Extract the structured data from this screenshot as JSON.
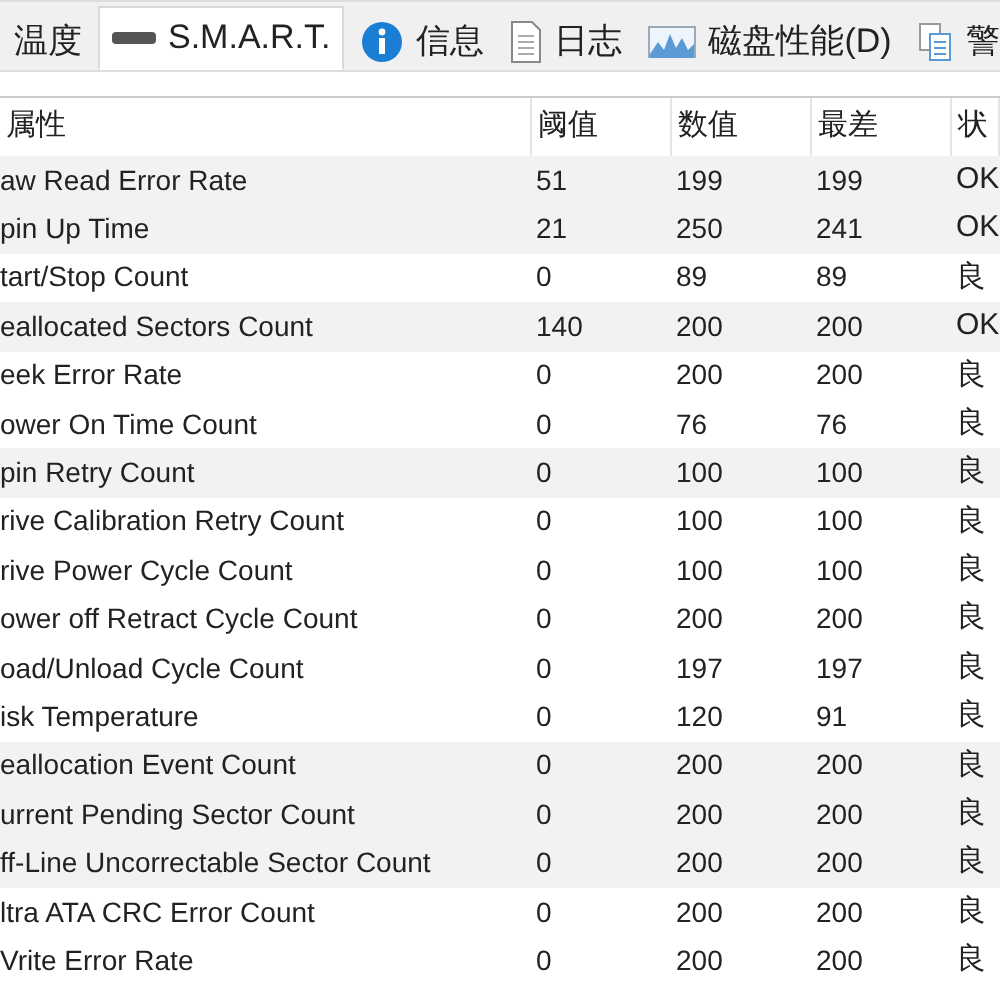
{
  "tabs": [
    {
      "label": "温度",
      "selected": false
    },
    {
      "label": "S.M.A.R.T.",
      "selected": true
    },
    {
      "label": "信息",
      "selected": false
    },
    {
      "label": "日志",
      "selected": false
    },
    {
      "label": "磁盘性能(D)",
      "selected": false
    },
    {
      "label": "警",
      "selected": false
    }
  ],
  "table": {
    "columns": [
      "属性",
      "阈值",
      "数值",
      "最差",
      "状"
    ],
    "rows": [
      {
        "attribute": "aw Read Error Rate",
        "threshold": "51",
        "value": "199",
        "worst": "199",
        "status": "OK",
        "highlighted": true
      },
      {
        "attribute": "pin Up Time",
        "threshold": "21",
        "value": "250",
        "worst": "241",
        "status": "OK",
        "highlighted": true
      },
      {
        "attribute": "tart/Stop Count",
        "threshold": "0",
        "value": "89",
        "worst": "89",
        "status": "良",
        "highlighted": false
      },
      {
        "attribute": "eallocated Sectors Count",
        "threshold": "140",
        "value": "200",
        "worst": "200",
        "status": "OK",
        "highlighted": true
      },
      {
        "attribute": "eek Error Rate",
        "threshold": "0",
        "value": "200",
        "worst": "200",
        "status": "良",
        "highlighted": false
      },
      {
        "attribute": "ower On Time Count",
        "threshold": "0",
        "value": "76",
        "worst": "76",
        "status": "良",
        "highlighted": false
      },
      {
        "attribute": "pin Retry Count",
        "threshold": "0",
        "value": "100",
        "worst": "100",
        "status": "良",
        "highlighted": true
      },
      {
        "attribute": "rive Calibration Retry Count",
        "threshold": "0",
        "value": "100",
        "worst": "100",
        "status": "良",
        "highlighted": false
      },
      {
        "attribute": "rive Power Cycle Count",
        "threshold": "0",
        "value": "100",
        "worst": "100",
        "status": "良",
        "highlighted": false
      },
      {
        "attribute": "ower off Retract Cycle Count",
        "threshold": "0",
        "value": "200",
        "worst": "200",
        "status": "良",
        "highlighted": false
      },
      {
        "attribute": "oad/Unload Cycle Count",
        "threshold": "0",
        "value": "197",
        "worst": "197",
        "status": "良",
        "highlighted": false
      },
      {
        "attribute": "isk Temperature",
        "threshold": "0",
        "value": "120",
        "worst": "91",
        "status": "良",
        "highlighted": false
      },
      {
        "attribute": "eallocation Event Count",
        "threshold": "0",
        "value": "200",
        "worst": "200",
        "status": "良",
        "highlighted": true
      },
      {
        "attribute": "urrent Pending Sector Count",
        "threshold": "0",
        "value": "200",
        "worst": "200",
        "status": "良",
        "highlighted": true
      },
      {
        "attribute": "ff-Line Uncorrectable Sector Count",
        "threshold": "0",
        "value": "200",
        "worst": "200",
        "status": "良",
        "highlighted": true
      },
      {
        "attribute": "ltra ATA CRC Error Count",
        "threshold": "0",
        "value": "200",
        "worst": "200",
        "status": "良",
        "highlighted": false
      },
      {
        "attribute": "Vrite Error Rate",
        "threshold": "0",
        "value": "200",
        "worst": "200",
        "status": "良",
        "highlighted": false
      }
    ]
  }
}
